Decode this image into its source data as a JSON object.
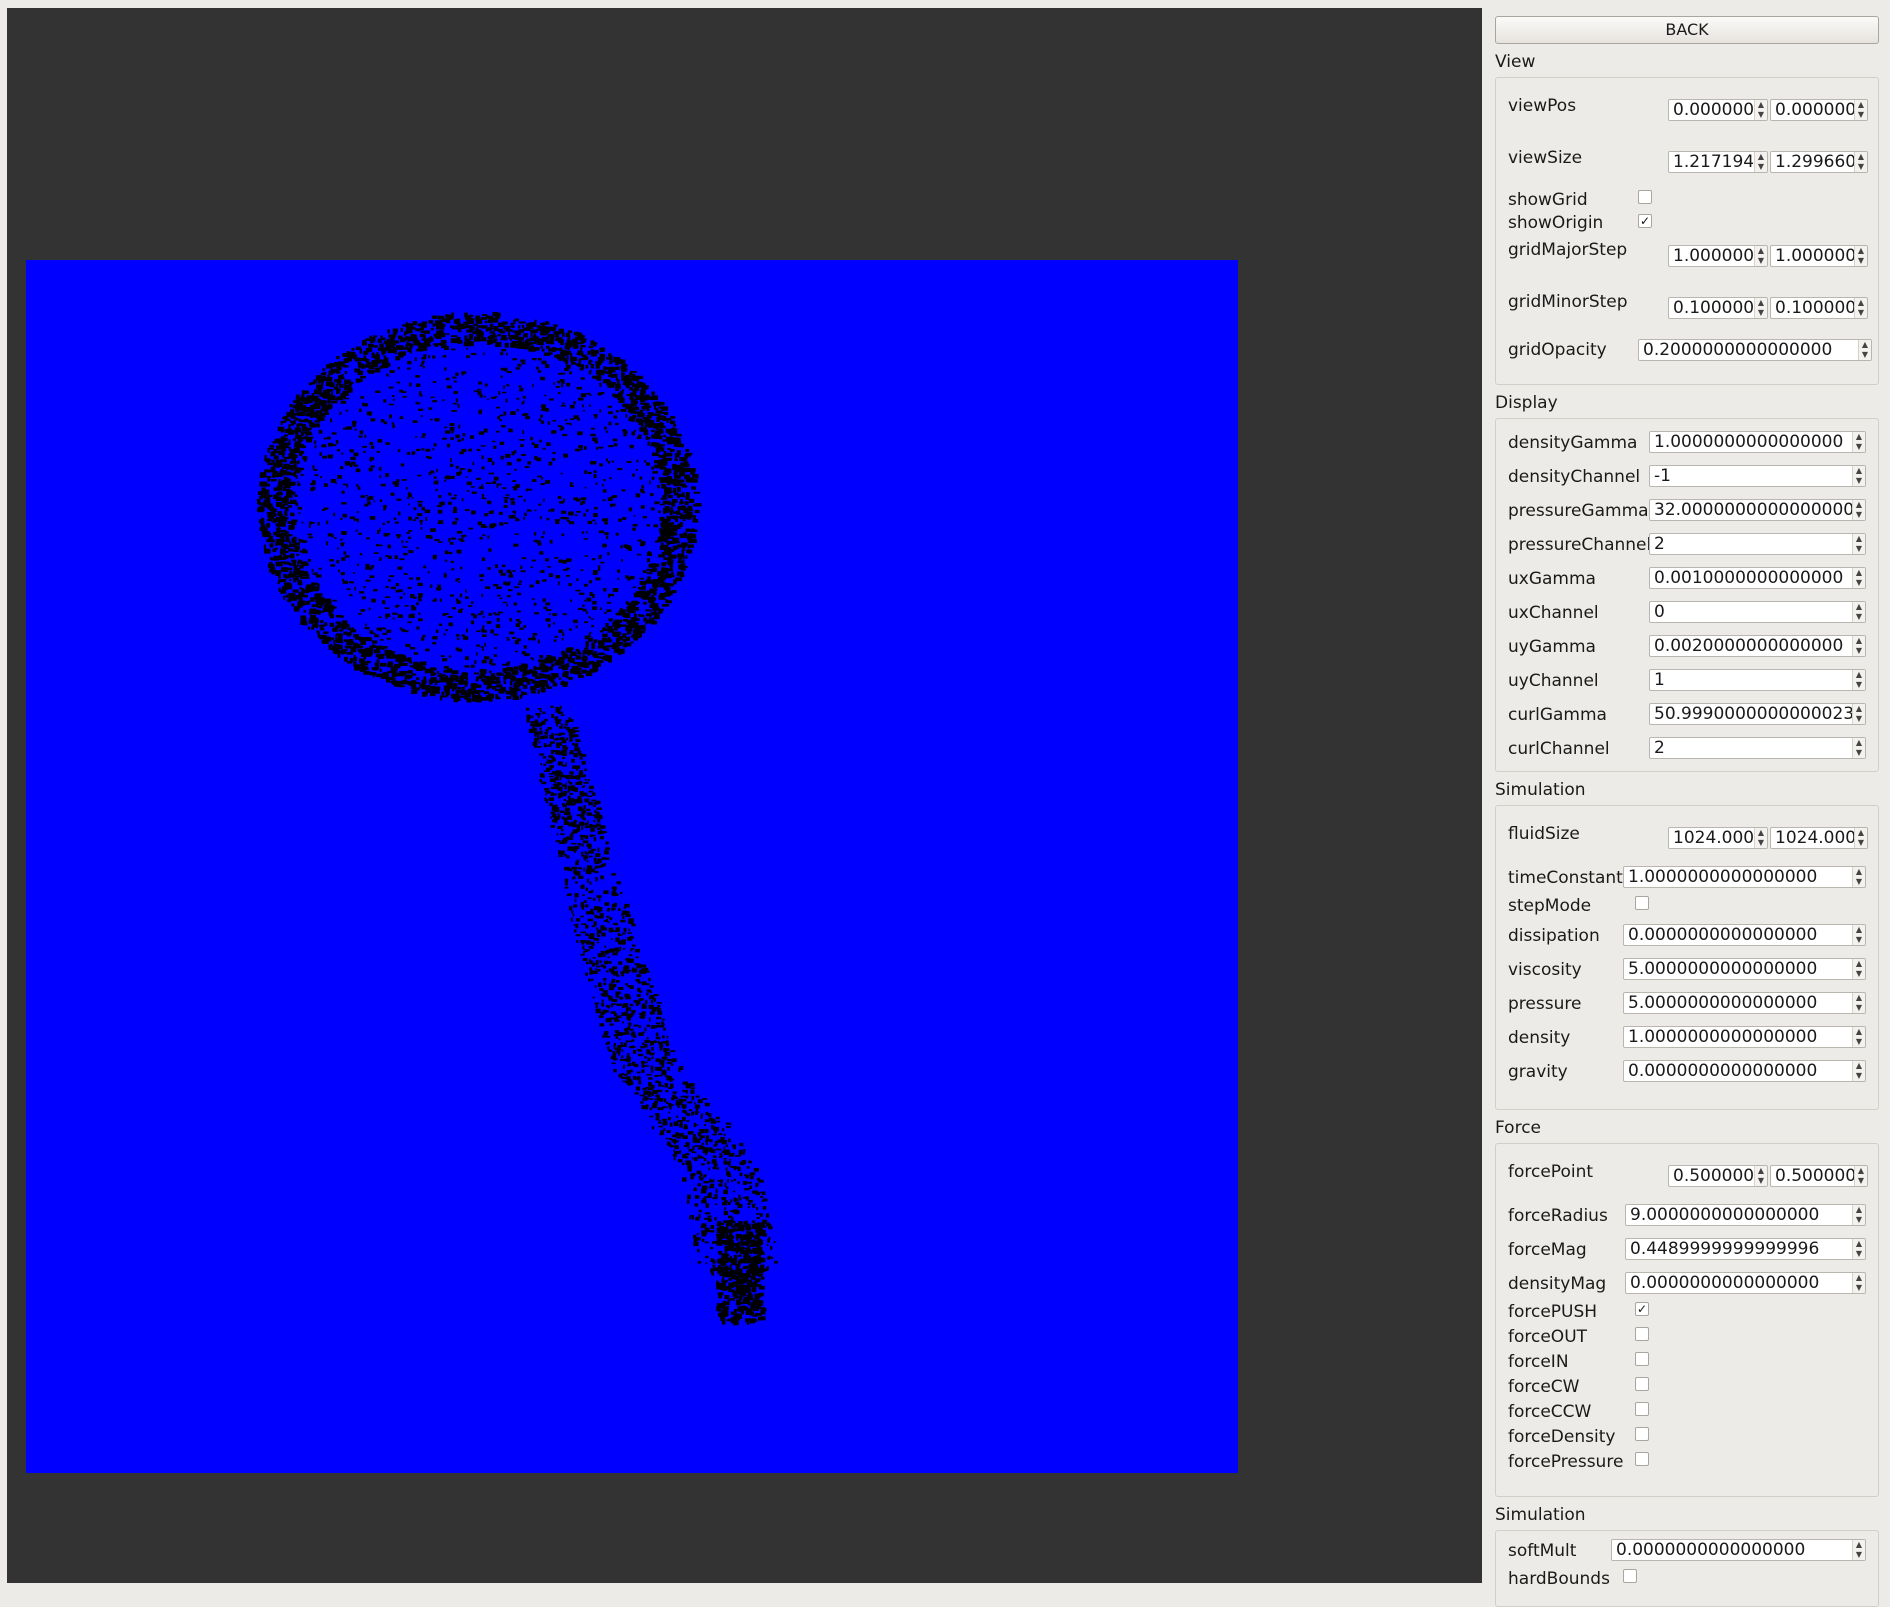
{
  "back_button": {
    "label": "BACK"
  },
  "view": {
    "title": "View",
    "viewPos": {
      "label": "viewPos",
      "x": "0.000000",
      "y": "0.000000"
    },
    "viewSize": {
      "label": "viewSize",
      "x": "1.217194",
      "y": "1.299660"
    },
    "showGrid": {
      "label": "showGrid",
      "checked": false
    },
    "showOrigin": {
      "label": "showOrigin",
      "checked": true
    },
    "gridMajorStep": {
      "label": "gridMajorStep",
      "x": "1.000000",
      "y": "1.000000"
    },
    "gridMinorStep": {
      "label": "gridMinorStep",
      "x": "0.100000",
      "y": "0.100000"
    },
    "gridOpacity": {
      "label": "gridOpacity",
      "value": "0.2000000000000000"
    }
  },
  "display": {
    "title": "Display",
    "densityGamma": {
      "label": "densityGamma",
      "value": "1.0000000000000000"
    },
    "densityChannel": {
      "label": "densityChannel",
      "value": "-1"
    },
    "pressureGamma": {
      "label": "pressureGamma",
      "value": "32.0000000000000000"
    },
    "pressureChannel": {
      "label": "pressureChannel",
      "value": "2"
    },
    "uxGamma": {
      "label": "uxGamma",
      "value": "0.0010000000000000"
    },
    "uxChannel": {
      "label": "uxChannel",
      "value": "0"
    },
    "uyGamma": {
      "label": "uyGamma",
      "value": "0.0020000000000000"
    },
    "uyChannel": {
      "label": "uyChannel",
      "value": "1"
    },
    "curlGamma": {
      "label": "curlGamma",
      "value": "50.9990000000000023"
    },
    "curlChannel": {
      "label": "curlChannel",
      "value": "2"
    }
  },
  "simulation": {
    "title": "Simulation",
    "fluidSize": {
      "label": "fluidSize",
      "x": "1024.000000",
      "y": "1024.000000"
    },
    "timeConstant": {
      "label": "timeConstant",
      "value": "1.0000000000000000"
    },
    "stepMode": {
      "label": "stepMode",
      "checked": false
    },
    "dissipation": {
      "label": "dissipation",
      "value": "0.0000000000000000"
    },
    "viscosity": {
      "label": "viscosity",
      "value": "5.0000000000000000"
    },
    "pressure": {
      "label": "pressure",
      "value": "5.0000000000000000"
    },
    "density": {
      "label": "density",
      "value": "1.0000000000000000"
    },
    "gravity": {
      "label": "gravity",
      "value": "0.0000000000000000"
    }
  },
  "force": {
    "title": "Force",
    "forcePoint": {
      "label": "forcePoint",
      "x": "0.500000",
      "y": "0.500000"
    },
    "forceRadius": {
      "label": "forceRadius",
      "value": "9.0000000000000000"
    },
    "forceMag": {
      "label": "forceMag",
      "value": "0.4489999999999996"
    },
    "densityMag": {
      "label": "densityMag",
      "value": "0.0000000000000000"
    },
    "forcePUSH": {
      "label": "forcePUSH",
      "checked": true
    },
    "forceOUT": {
      "label": "forceOUT",
      "checked": false
    },
    "forceIN": {
      "label": "forceIN",
      "checked": false
    },
    "forceCW": {
      "label": "forceCW",
      "checked": false
    },
    "forceCCW": {
      "label": "forceCCW",
      "checked": false
    },
    "forceDensity": {
      "label": "forceDensity",
      "checked": false
    },
    "forcePressure": {
      "label": "forcePressure",
      "checked": false
    }
  },
  "simulation2": {
    "title": "Simulation",
    "softMult": {
      "label": "softMult",
      "value": "0.0000000000000000"
    },
    "hardBounds": {
      "label": "hardBounds",
      "checked": false
    }
  },
  "colors": {
    "viewport_bg": "#333333",
    "fluid_bg": "#0000ff",
    "particles": "#000000",
    "panel_bg": "#edebe7"
  }
}
